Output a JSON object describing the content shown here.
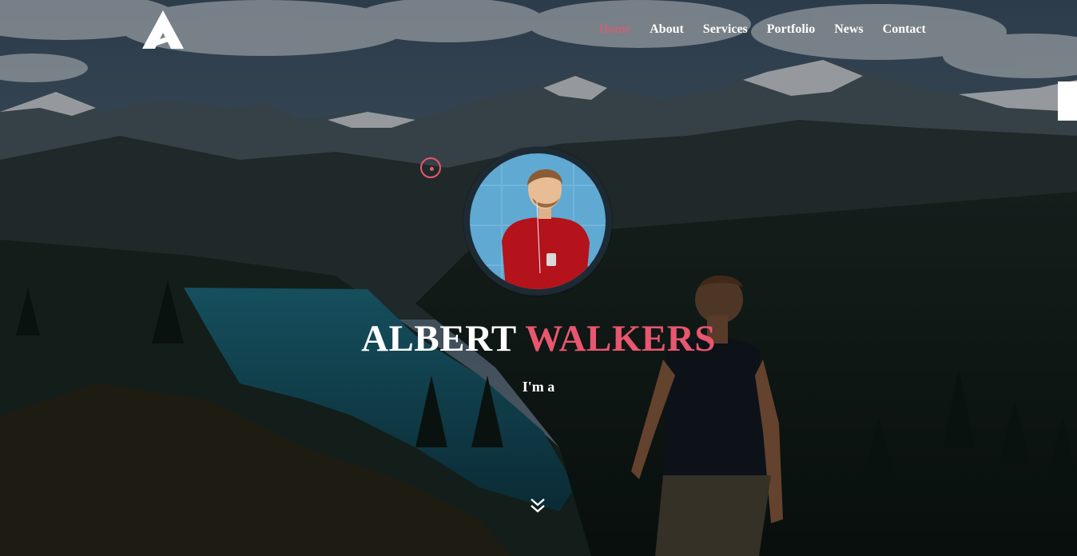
{
  "brand": {
    "logo_icon": "triangle-a-logo-icon"
  },
  "nav": {
    "items": [
      {
        "label": "Home",
        "active": true
      },
      {
        "label": "About"
      },
      {
        "label": "Services"
      },
      {
        "label": "Portfolio"
      },
      {
        "label": "News"
      },
      {
        "label": "Contact"
      }
    ]
  },
  "hero": {
    "name_first": "ALBERT",
    "name_last": "WALKERS",
    "tagline": "I'm a",
    "scroll_icon": "double-chevron-down-icon"
  },
  "colors": {
    "accent": "#e8566f",
    "text": "#ffffff"
  }
}
